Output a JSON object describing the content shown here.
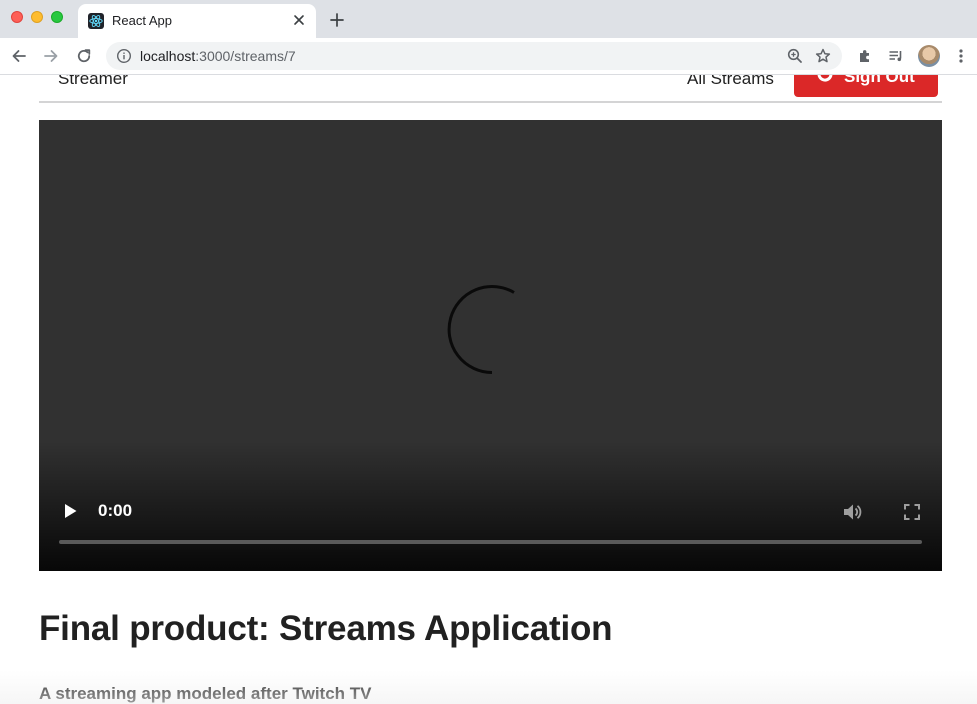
{
  "browser": {
    "tab": {
      "title": "React App",
      "favicon": "react-logo-icon"
    },
    "address_bar": {
      "host": "localhost",
      "rest": ":3000/streams/7"
    }
  },
  "app": {
    "navbar": {
      "brand": "Streamer",
      "all_streams_link": "All Streams",
      "signout_label": "Sign Out",
      "signout_color": "#db2828"
    },
    "player": {
      "current_time": "0:00",
      "state": "loading",
      "background": "#313131"
    },
    "stream": {
      "title": "Final product: Streams Application",
      "description": "A streaming app modeled after Twitch TV"
    }
  }
}
